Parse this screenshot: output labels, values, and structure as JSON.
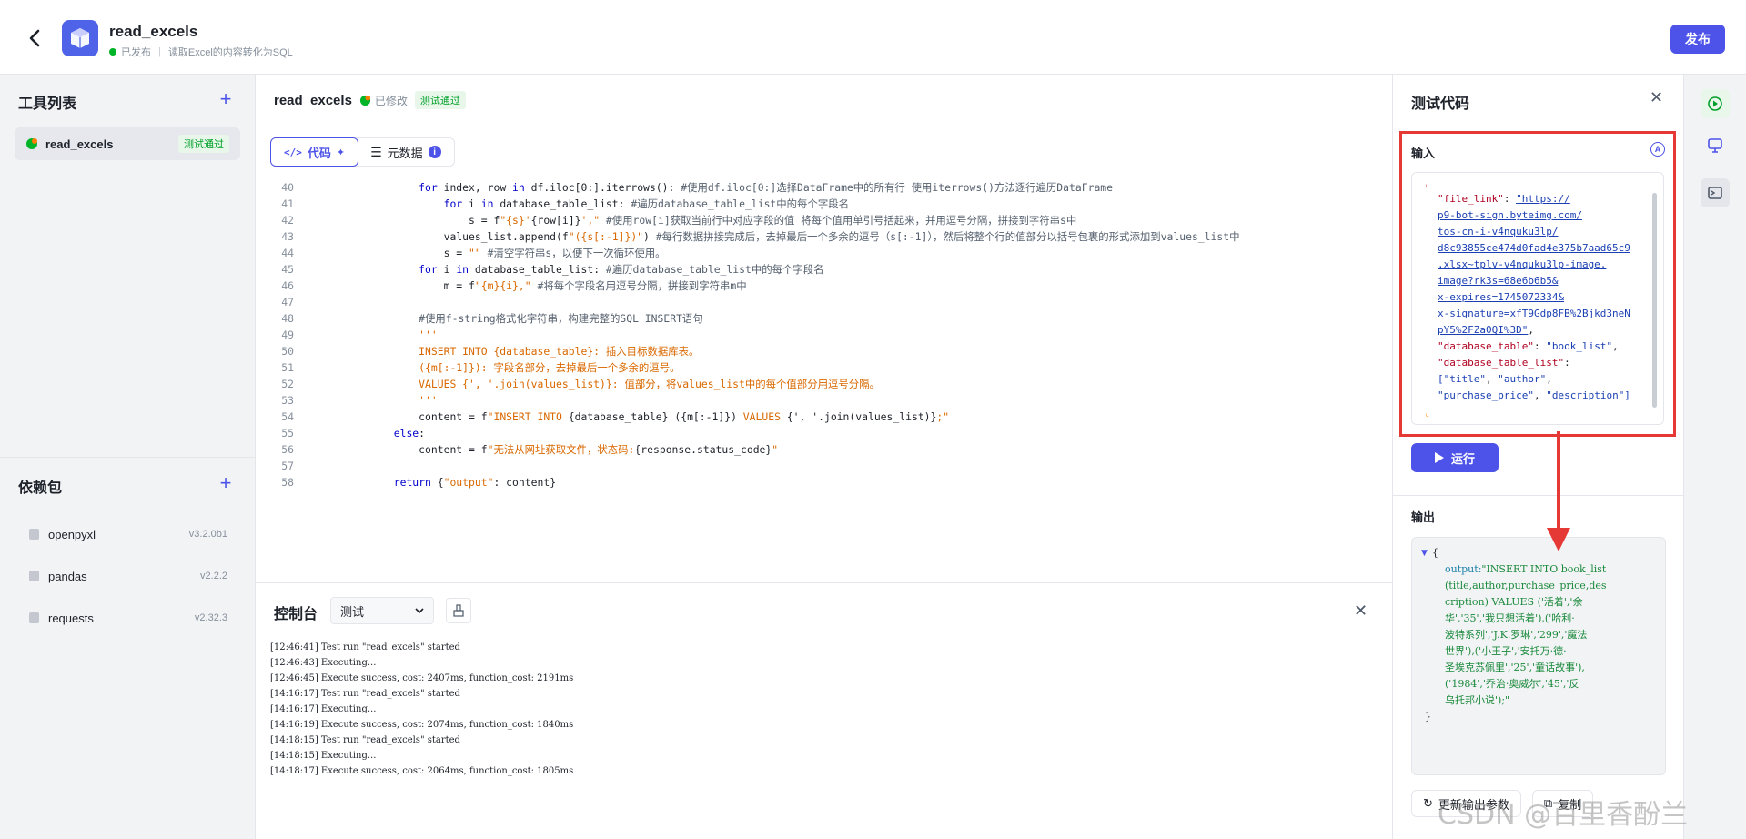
{
  "header": {
    "app_name": "read_excels",
    "status": "已发布",
    "description": "读取Excel的内容转化为SQL",
    "publish_label": "发布"
  },
  "sidebar": {
    "tools_title": "工具列表",
    "tools": [
      {
        "name": "read_excels",
        "badge": "测试通过"
      }
    ],
    "deps_title": "依赖包",
    "deps": [
      {
        "name": "openpyxl",
        "version": "v3.2.0b1"
      },
      {
        "name": "pandas",
        "version": "v2.2.2"
      },
      {
        "name": "requests",
        "version": "v2.32.3"
      }
    ]
  },
  "main": {
    "title": "read_excels",
    "modified": "已修改",
    "badge": "测试通过",
    "tabs": [
      {
        "label": "代码"
      },
      {
        "label": "元数据"
      }
    ],
    "code_lines": [
      {
        "n": "40",
        "t": [
          [
            "kw",
            "        for "
          ],
          [
            "src",
            "index, row "
          ],
          [
            "kw",
            "in "
          ],
          [
            "src",
            "df.iloc[0:].iterrows(): "
          ],
          [
            "com",
            "#使用df.iloc[0:]选择DataFrame中的所有行 使用iterrows()方法逐行遍历DataFrame"
          ]
        ]
      },
      {
        "n": "41",
        "t": [
          [
            "kw",
            "            for "
          ],
          [
            "src",
            "i "
          ],
          [
            "kw",
            "in "
          ],
          [
            "src",
            "database_table_list: "
          ],
          [
            "com",
            "#遍历database_table_list中的每个字段名"
          ]
        ]
      },
      {
        "n": "42",
        "t": [
          [
            "src",
            "                s = f"
          ],
          [
            "str",
            "\"{s}'"
          ],
          [
            "src",
            "{row[i]}"
          ],
          [
            "str",
            "',\""
          ],
          [
            "src",
            " "
          ],
          [
            "com",
            "#使用row[i]获取当前行中对应字段的值 将每个值用单引号括起来，并用逗号分隔，拼接到字符串s中"
          ]
        ]
      },
      {
        "n": "43",
        "t": [
          [
            "src",
            "            values_list.append(f"
          ],
          [
            "str",
            "\"({s[:-1]})\""
          ],
          [
            "src",
            ") "
          ],
          [
            "com",
            "#每行数据拼接完成后，去掉最后一个多余的逗号（s[:-1]），然后将整个行的值部分以括号包裹的形式添加到values_list中"
          ]
        ]
      },
      {
        "n": "44",
        "t": [
          [
            "src",
            "            s = "
          ],
          [
            "str",
            "\"\""
          ],
          [
            "src",
            " "
          ],
          [
            "com",
            "#清空字符串s，以便下一次循环使用。"
          ]
        ]
      },
      {
        "n": "45",
        "t": [
          [
            "kw",
            "        for "
          ],
          [
            "src",
            "i "
          ],
          [
            "kw",
            "in "
          ],
          [
            "src",
            "database_table_list: "
          ],
          [
            "com",
            "#遍历database_table_list中的每个字段名"
          ]
        ]
      },
      {
        "n": "46",
        "t": [
          [
            "src",
            "            m = f"
          ],
          [
            "str",
            "\"{m}{i},\""
          ],
          [
            "src",
            " "
          ],
          [
            "com",
            "#将每个字段名用逗号分隔，拼接到字符串m中"
          ]
        ]
      },
      {
        "n": "47",
        "t": []
      },
      {
        "n": "48",
        "t": [
          [
            "com",
            "        #使用f-string格式化字符串，构建完整的SQL INSERT语句"
          ]
        ]
      },
      {
        "n": "49",
        "t": [
          [
            "str",
            "        '''"
          ]
        ]
      },
      {
        "n": "50",
        "t": [
          [
            "str",
            "        INSERT INTO {database_table}: 插入目标数据库表。"
          ]
        ]
      },
      {
        "n": "51",
        "t": [
          [
            "str",
            "        ({m[:-1]}): 字段名部分，去掉最后一个多余的逗号。"
          ]
        ]
      },
      {
        "n": "52",
        "t": [
          [
            "str",
            "        VALUES {', '.join(values_list)}: 值部分，将values_list中的每个值部分用逗号分隔。"
          ]
        ]
      },
      {
        "n": "53",
        "t": [
          [
            "str",
            "        '''"
          ]
        ]
      },
      {
        "n": "54",
        "t": [
          [
            "src",
            "        content = f"
          ],
          [
            "str",
            "\"INSERT INTO "
          ],
          [
            "src",
            "{database_table} ({m[:-1]})"
          ],
          [
            "str",
            " VALUES "
          ],
          [
            "src",
            "{', '.join(values_list)}"
          ],
          [
            "str",
            ";\""
          ]
        ]
      },
      {
        "n": "55",
        "t": [
          [
            "kw",
            "    else"
          ],
          [
            "src",
            ":"
          ]
        ]
      },
      {
        "n": "56",
        "t": [
          [
            "src",
            "        content = f"
          ],
          [
            "str",
            "\"无法从网址获取文件，状态码:"
          ],
          [
            "src",
            "{response.status_code}"
          ],
          [
            "str",
            "\""
          ]
        ]
      },
      {
        "n": "57",
        "t": []
      },
      {
        "n": "58",
        "t": [
          [
            "kw",
            "    return "
          ],
          [
            "src",
            "{"
          ],
          [
            "str",
            "\"output\""
          ],
          [
            "src",
            ": content}"
          ]
        ]
      }
    ]
  },
  "console": {
    "title": "控制台",
    "select_value": "测试",
    "logs": [
      "[12:46:41] Test run \"read_excels\" started",
      "[12:46:43] Executing...",
      "[12:46:45] Execute success, cost: 2407ms, function_cost: 2191ms",
      "[14:16:17] Test run \"read_excels\" started",
      "[14:16:17] Executing...",
      "[14:16:19] Execute success, cost: 2074ms, function_cost: 1840ms",
      "[14:18:15] Test run \"read_excels\" started",
      "[14:18:15] Executing...",
      "[14:18:17] Execute success, cost: 2064ms, function_cost: 1805ms"
    ]
  },
  "test_panel": {
    "title": "测试代码",
    "input_label": "输入",
    "input_json": [
      {
        "parts": [
          [
            "jk",
            "\"file_link\""
          ],
          [
            "p",
            ": "
          ],
          [
            "jlink",
            "\"https://"
          ]
        ]
      },
      {
        "parts": [
          [
            "jlink",
            "p9-bot-sign.byteimg.com/"
          ]
        ]
      },
      {
        "parts": [
          [
            "jlink",
            "tos-cn-i-v4nquku3lp/"
          ]
        ]
      },
      {
        "parts": [
          [
            "jlink",
            "d8c93855ce474d0fad4e375b7aad65c9"
          ]
        ]
      },
      {
        "parts": [
          [
            "jlink",
            ".xlsx~tplv-v4nquku3lp-image."
          ]
        ]
      },
      {
        "parts": [
          [
            "jlink",
            "image?rk3s=68e6b6b5&"
          ]
        ]
      },
      {
        "parts": [
          [
            "jlink",
            "x-expires=1745072334&"
          ]
        ]
      },
      {
        "parts": [
          [
            "jlink",
            "x-signature=xfT9Gdp8FB%2Bjkd3neN"
          ]
        ]
      },
      {
        "parts": [
          [
            "jlink",
            "pY5%2FZa0QI%3D\""
          ],
          [
            "p",
            ","
          ]
        ]
      },
      {
        "parts": [
          [
            "jk",
            "\"database_table\""
          ],
          [
            "p",
            ": "
          ],
          [
            "jv",
            "\"book_list\""
          ],
          [
            "p",
            ","
          ]
        ]
      },
      {
        "parts": [
          [
            "jk",
            "\"database_table_list\""
          ],
          [
            "p",
            ":"
          ]
        ]
      },
      {
        "parts": [
          [
            "jv",
            "[\"title\""
          ],
          [
            "p",
            ", "
          ],
          [
            "jv",
            "\"author\""
          ],
          [
            "p",
            ","
          ]
        ]
      },
      {
        "parts": [
          [
            "jv",
            "\"purchase_price\""
          ],
          [
            "p",
            ", "
          ],
          [
            "jv",
            "\"description\"]"
          ]
        ]
      }
    ],
    "run_label": "运行",
    "output_label": "输出",
    "output_key": "output",
    "output_lines": [
      "\"INSERT INTO book_list",
      "(title,author,purchase_price,des",
      "cription) VALUES ('活着','余",
      "华','35','我只想活着'),('哈利·",
      "波特系列','J.K.罗琳','299','魔法",
      "世界'),('小王子','安托万·德·",
      "圣埃克苏佩里','25','童话故事'),",
      "('1984','乔治·奥威尔','45','反",
      "乌托邦小说');\""
    ],
    "update_params_label": "更新输出参数",
    "copy_label": "复制"
  },
  "watermark": "CSDN @百里香酚兰"
}
